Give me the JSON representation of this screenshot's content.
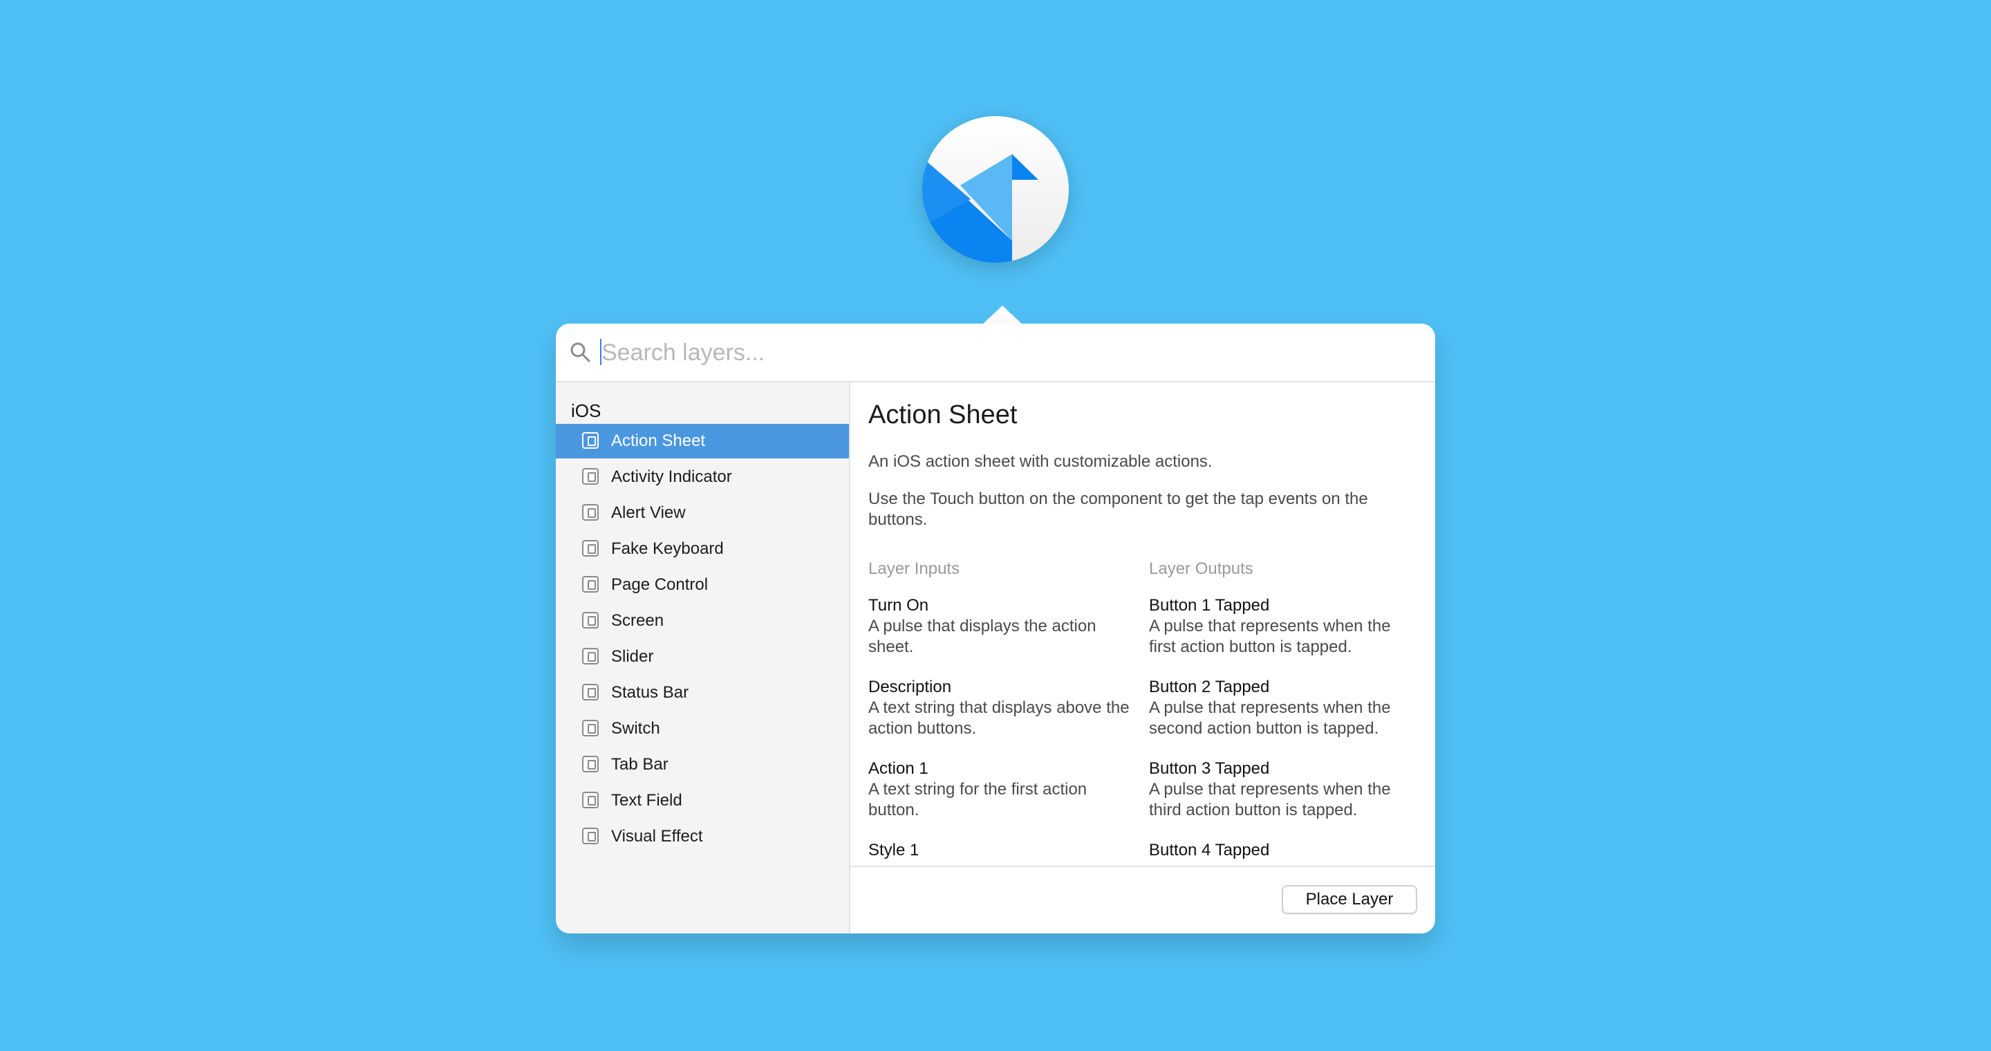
{
  "search": {
    "placeholder": "Search layers..."
  },
  "sidebar": {
    "section_title": "iOS",
    "items": [
      {
        "label": "Action Sheet",
        "selected": true
      },
      {
        "label": "Activity Indicator"
      },
      {
        "label": "Alert View"
      },
      {
        "label": "Fake Keyboard"
      },
      {
        "label": "Page Control"
      },
      {
        "label": "Screen"
      },
      {
        "label": "Slider"
      },
      {
        "label": "Status Bar"
      },
      {
        "label": "Switch"
      },
      {
        "label": "Tab Bar"
      },
      {
        "label": "Text Field"
      },
      {
        "label": "Visual Effect"
      }
    ]
  },
  "detail": {
    "title": "Action Sheet",
    "description": "An iOS action sheet with customizable actions.",
    "usage": "Use the Touch button on the component to get the tap events on the buttons.",
    "inputs_heading": "Layer Inputs",
    "outputs_heading": "Layer Outputs",
    "inputs": [
      {
        "name": "Turn On",
        "desc": "A pulse that displays the action sheet."
      },
      {
        "name": "Description",
        "desc": "A text string that displays above the action buttons."
      },
      {
        "name": "Action 1",
        "desc": "A text string for the first action button."
      },
      {
        "name": "Style 1",
        "desc": ""
      }
    ],
    "outputs": [
      {
        "name": "Button 1 Tapped",
        "desc": "A pulse that represents when the first action button is tapped."
      },
      {
        "name": "Button 2 Tapped",
        "desc": "A pulse that represents when the second action button is tapped."
      },
      {
        "name": "Button 3 Tapped",
        "desc": "A pulse that represents when the third action button is tapped."
      },
      {
        "name": "Button 4 Tapped",
        "desc": ""
      }
    ]
  },
  "footer": {
    "place_label": "Place Layer"
  },
  "colors": {
    "background": "#4fc0f5",
    "selection": "#4a97e0",
    "icon_blue": "#0a84f0"
  },
  "icons": {
    "app": "origami-app-icon",
    "search": "magnifier-icon",
    "item": "layer-component-icon"
  }
}
